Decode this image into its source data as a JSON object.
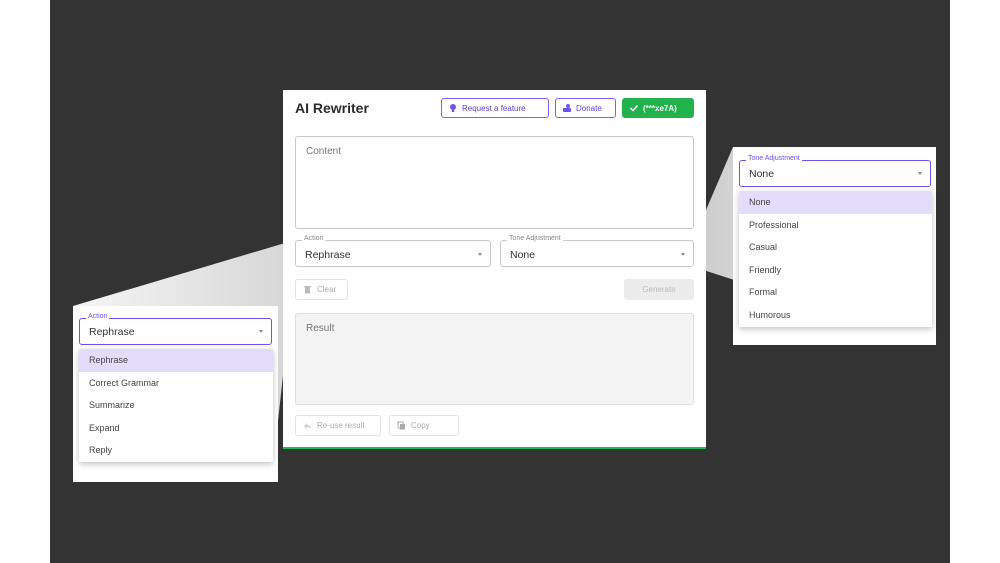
{
  "colors": {
    "accent": "#6f4ef2",
    "success": "#22b24c",
    "selected_item_bg": "#e3dcfb",
    "stage_bg": "#333333"
  },
  "app": {
    "title": "AI Rewriter",
    "request_feature_label": "Request a feature",
    "donate_label": "Donate",
    "license_label": "(***xe7A)"
  },
  "content": {
    "placeholder": "Content"
  },
  "action_select": {
    "label": "Action",
    "value": "Rephrase"
  },
  "tone_select": {
    "label": "Tone Adjustment",
    "value": "None"
  },
  "buttons": {
    "clear": "Clear",
    "generate": "Generate",
    "reuse": "Re-use result",
    "copy": "Copy"
  },
  "result": {
    "placeholder": "Result"
  },
  "action_popup": {
    "label": "Action",
    "value": "Rephrase",
    "options": [
      "Rephrase",
      "Correct Grammar",
      "Summarize",
      "Expand",
      "Reply"
    ],
    "selected_index": 0
  },
  "tone_popup": {
    "label": "Tone Adjustment",
    "value": "None",
    "options": [
      "None",
      "Professional",
      "Casual",
      "Friendly",
      "Formal",
      "Humorous"
    ],
    "selected_index": 0
  }
}
